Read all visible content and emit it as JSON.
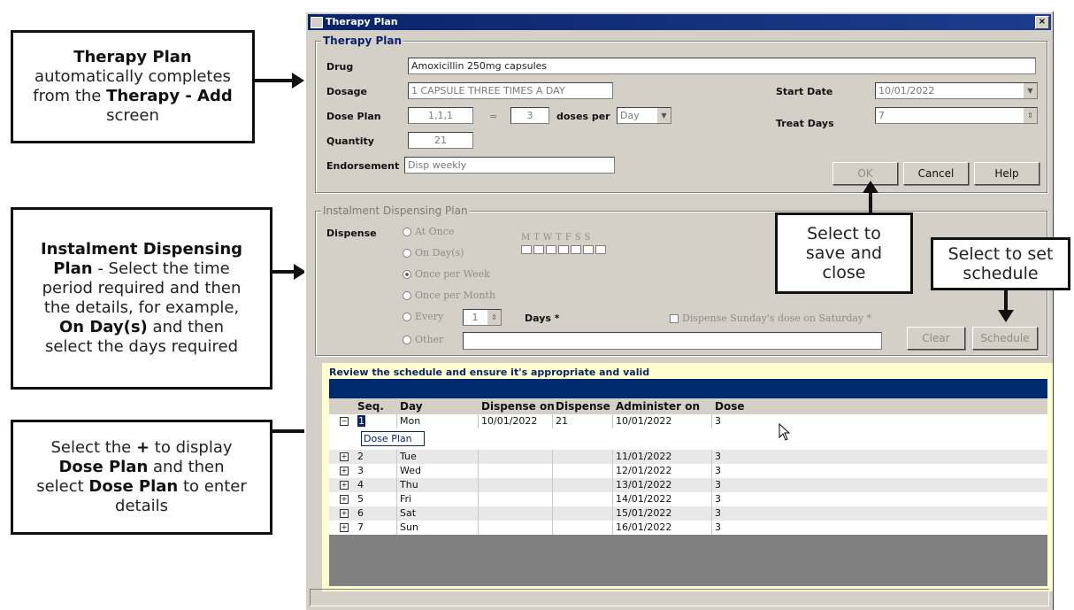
{
  "callouts": {
    "c1": {
      "l1": "Therapy Plan",
      "l2": "automatically completes",
      "l3a": "from the ",
      "l3b": "Therapy - Add",
      "l4": "screen"
    },
    "c2": {
      "l1": "Instalment Dispensing",
      "l2a": "Plan",
      "l2b": " - Select the time",
      "l3": "period required and then",
      "l4": "the details, for example,",
      "l5a": "On Day(s)",
      "l5b": " and then",
      "l6": "select the days required"
    },
    "c3": {
      "l1a": "Select the ",
      "l1b": "+",
      "l1c": " to display",
      "l2a": "Dose Plan",
      "l2b": " and then",
      "l3a": "select ",
      "l3b": "Dose Plan",
      "l3c": " to enter",
      "l4": "details"
    },
    "c4": {
      "l1": "Select to",
      "l2": "save and",
      "l3": "close"
    },
    "c5": {
      "l1": "Select to set",
      "l2": "schedule"
    }
  },
  "window": {
    "title": "Therapy Plan",
    "close": "×",
    "therapy_group": "Therapy Plan",
    "drug_label": "Drug",
    "drug_value": "Amoxicillin 250mg capsules",
    "dosage_label": "Dosage",
    "dosage_value": "1 CAPSULE THREE TIMES A DAY",
    "doseplan_label": "Dose Plan",
    "doseplan_value": "1,1,1",
    "equals": "=",
    "doses_value": "3",
    "doses_per_label": "doses per",
    "per_value": "Day",
    "quantity_label": "Quantity",
    "quantity_value": "21",
    "endorsement_label": "Endorsement",
    "endorsement_value": "Disp weekly",
    "start_label": "Start Date",
    "start_value": "10/01/2022",
    "treat_label": "Treat Days",
    "treat_value": "7",
    "ok": "OK",
    "cancel": "Cancel",
    "help": "Help"
  },
  "instalment": {
    "group": "Instalment Dispensing Plan",
    "dispense_label": "Dispense",
    "at_once": "At Once",
    "on_days": "On Day(s)",
    "once_week": "Once per Week",
    "once_month": "Once per Month",
    "every": "Every",
    "every_value": "1",
    "days_label": "Days *",
    "other": "Other",
    "day_letters": "MTWTFSS",
    "sunday_label": "Dispense Sunday's dose on Saturday *",
    "clear": "Clear",
    "schedule": "Schedule"
  },
  "review": {
    "title": "Review the schedule and ensure it's appropriate and valid",
    "headers": {
      "seq": "Seq.",
      "day": "Day",
      "dispense_on": "Dispense on",
      "dispense": "Dispense",
      "administer_on": "Administer on",
      "dose": "Dose"
    },
    "dose_plan_label": "Dose Plan",
    "rows": [
      {
        "seq": "1",
        "day": "Mon",
        "dispense_on": "10/01/2022",
        "dispense": "21",
        "administer_on": "10/01/2022",
        "dose": "3"
      },
      {
        "seq": "2",
        "day": "Tue",
        "dispense_on": "",
        "dispense": "",
        "administer_on": "11/01/2022",
        "dose": "3"
      },
      {
        "seq": "3",
        "day": "Wed",
        "dispense_on": "",
        "dispense": "",
        "administer_on": "12/01/2022",
        "dose": "3"
      },
      {
        "seq": "4",
        "day": "Thu",
        "dispense_on": "",
        "dispense": "",
        "administer_on": "13/01/2022",
        "dose": "3"
      },
      {
        "seq": "5",
        "day": "Fri",
        "dispense_on": "",
        "dispense": "",
        "administer_on": "14/01/2022",
        "dose": "3"
      },
      {
        "seq": "6",
        "day": "Sat",
        "dispense_on": "",
        "dispense": "",
        "administer_on": "15/01/2022",
        "dose": "3"
      },
      {
        "seq": "7",
        "day": "Sun",
        "dispense_on": "",
        "dispense": "",
        "administer_on": "16/01/2022",
        "dose": "3"
      }
    ]
  },
  "colors": {
    "accent": "#0a246a",
    "grid_band": "#002a6e",
    "review_bg": "#ffffd0"
  }
}
